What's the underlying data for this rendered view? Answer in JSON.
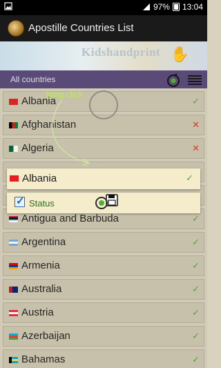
{
  "status_bar": {
    "battery": "97%",
    "time": "13:04"
  },
  "app": {
    "title": "Apostille Countries List"
  },
  "banner": {
    "text": "Kidshandprint"
  },
  "filter": {
    "label": "All countries"
  },
  "hint": {
    "text": "long click"
  },
  "countries": [
    {
      "name": "Albania",
      "status": "ok",
      "flag_color": "#e41e20"
    },
    {
      "name": "Afghanistan",
      "status": "no",
      "flag_color": "#007a36"
    },
    {
      "name": "Algeria",
      "status": "no",
      "flag_color": "#006233"
    },
    {
      "name": "",
      "status": "",
      "flag_color": ""
    },
    {
      "name": "",
      "status": "",
      "flag_color": ""
    },
    {
      "name": "Antigua and Barbuda",
      "status": "ok",
      "flag_color": "#ce1126"
    },
    {
      "name": "Argentina",
      "status": "ok",
      "flag_color": "#74acdf"
    },
    {
      "name": "Armenia",
      "status": "ok",
      "flag_color": "#d90012"
    },
    {
      "name": "Australia",
      "status": "ok",
      "flag_color": "#012169"
    },
    {
      "name": "Austria",
      "status": "ok",
      "flag_color": "#ed2939"
    },
    {
      "name": "Azerbaijan",
      "status": "ok",
      "flag_color": "#00b5e2"
    },
    {
      "name": "Bahamas",
      "status": "ok",
      "flag_color": "#00abc9"
    }
  ],
  "popup": {
    "country": "Albania",
    "status": "ok",
    "status_label": "Status"
  },
  "colors": {
    "ok": "#5aa23c",
    "no": "#d0392b",
    "filter_bar": "#57477a",
    "hint": "#b5f04a"
  }
}
